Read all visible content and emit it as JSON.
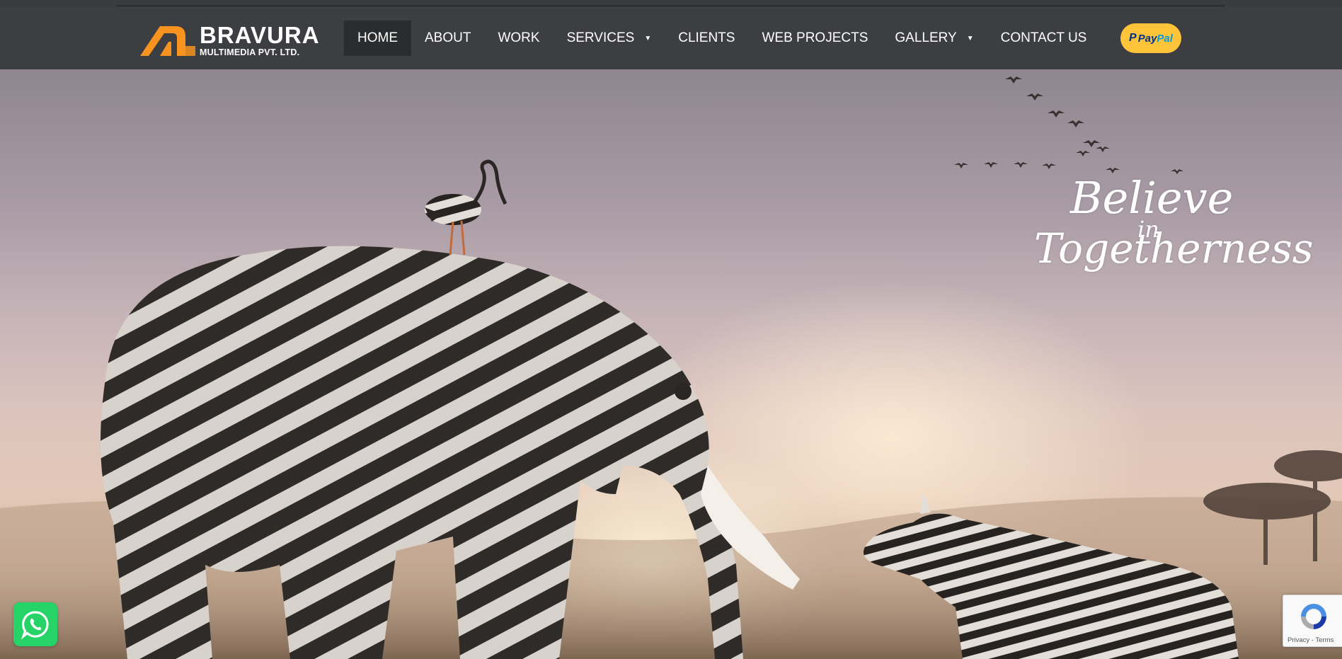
{
  "brand": {
    "name": "BRAVURA",
    "subtitle": "MULTIMEDIA PVT. LTD.",
    "accent": "#f7931e"
  },
  "nav": {
    "items": [
      {
        "label": "HOME",
        "active": true
      },
      {
        "label": "ABOUT"
      },
      {
        "label": "WORK"
      },
      {
        "label": "SERVICES",
        "has_dropdown": true
      },
      {
        "label": "CLIENTS"
      },
      {
        "label": "WEB PROJECTS"
      },
      {
        "label": "GALLERY",
        "has_dropdown": true
      },
      {
        "label": "CONTACT US"
      }
    ],
    "dropdown_caret": "▼",
    "paypal": {
      "mark": "P",
      "label_part1": "Pay",
      "label_part2": "Pal",
      "color": "#ffc439"
    }
  },
  "hero": {
    "tagline_line1": "Believe",
    "tagline_line2": "in",
    "tagline_line3": "Togetherness"
  },
  "widgets": {
    "whatsapp_icon": "whatsapp-icon",
    "recaptcha_links": "Privacy - Terms"
  },
  "colors": {
    "navbar": "#3d3e41",
    "active_item": "#2b2c2e",
    "whatsapp": "#25d366"
  }
}
